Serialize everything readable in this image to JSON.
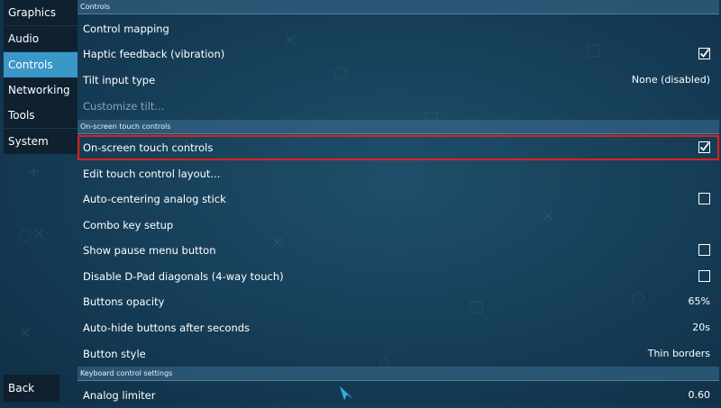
{
  "colors": {
    "accent": "#3a97c8",
    "highlight_border": "#e0201e",
    "background": "#17405a"
  },
  "sidebar": {
    "items": [
      {
        "label": "Graphics",
        "active": false
      },
      {
        "label": "Audio",
        "active": false
      },
      {
        "label": "Controls",
        "active": true
      },
      {
        "label": "Networking",
        "active": false
      },
      {
        "label": "Tools",
        "active": false
      },
      {
        "label": "System",
        "active": false
      }
    ],
    "back_label": "Back"
  },
  "sections": {
    "controls": "Controls",
    "touch": "On-screen touch controls",
    "keyboard": "Keyboard control settings"
  },
  "rows": {
    "control_mapping": {
      "label": "Control mapping"
    },
    "haptic": {
      "label": "Haptic feedback (vibration)",
      "checked": true
    },
    "tilt": {
      "label": "Tilt input type",
      "value": "None (disabled)"
    },
    "customize_tilt": {
      "label": "Customize tilt...",
      "disabled": true
    },
    "touch_controls": {
      "label": "On-screen touch controls",
      "checked": true
    },
    "edit_layout": {
      "label": "Edit touch control layout..."
    },
    "auto_center": {
      "label": "Auto-centering analog stick",
      "checked": false
    },
    "combo": {
      "label": "Combo key setup"
    },
    "pause_btn": {
      "label": "Show pause menu button",
      "checked": false
    },
    "dpad": {
      "label": "Disable D-Pad diagonals (4-way touch)",
      "checked": false
    },
    "opacity": {
      "label": "Buttons opacity",
      "value": "65%"
    },
    "autohide": {
      "label": "Auto-hide buttons after seconds",
      "value": "20s"
    },
    "button_style": {
      "label": "Button style",
      "value": "Thin borders"
    },
    "analog_limiter": {
      "label": "Analog limiter",
      "value": "0.60"
    }
  }
}
